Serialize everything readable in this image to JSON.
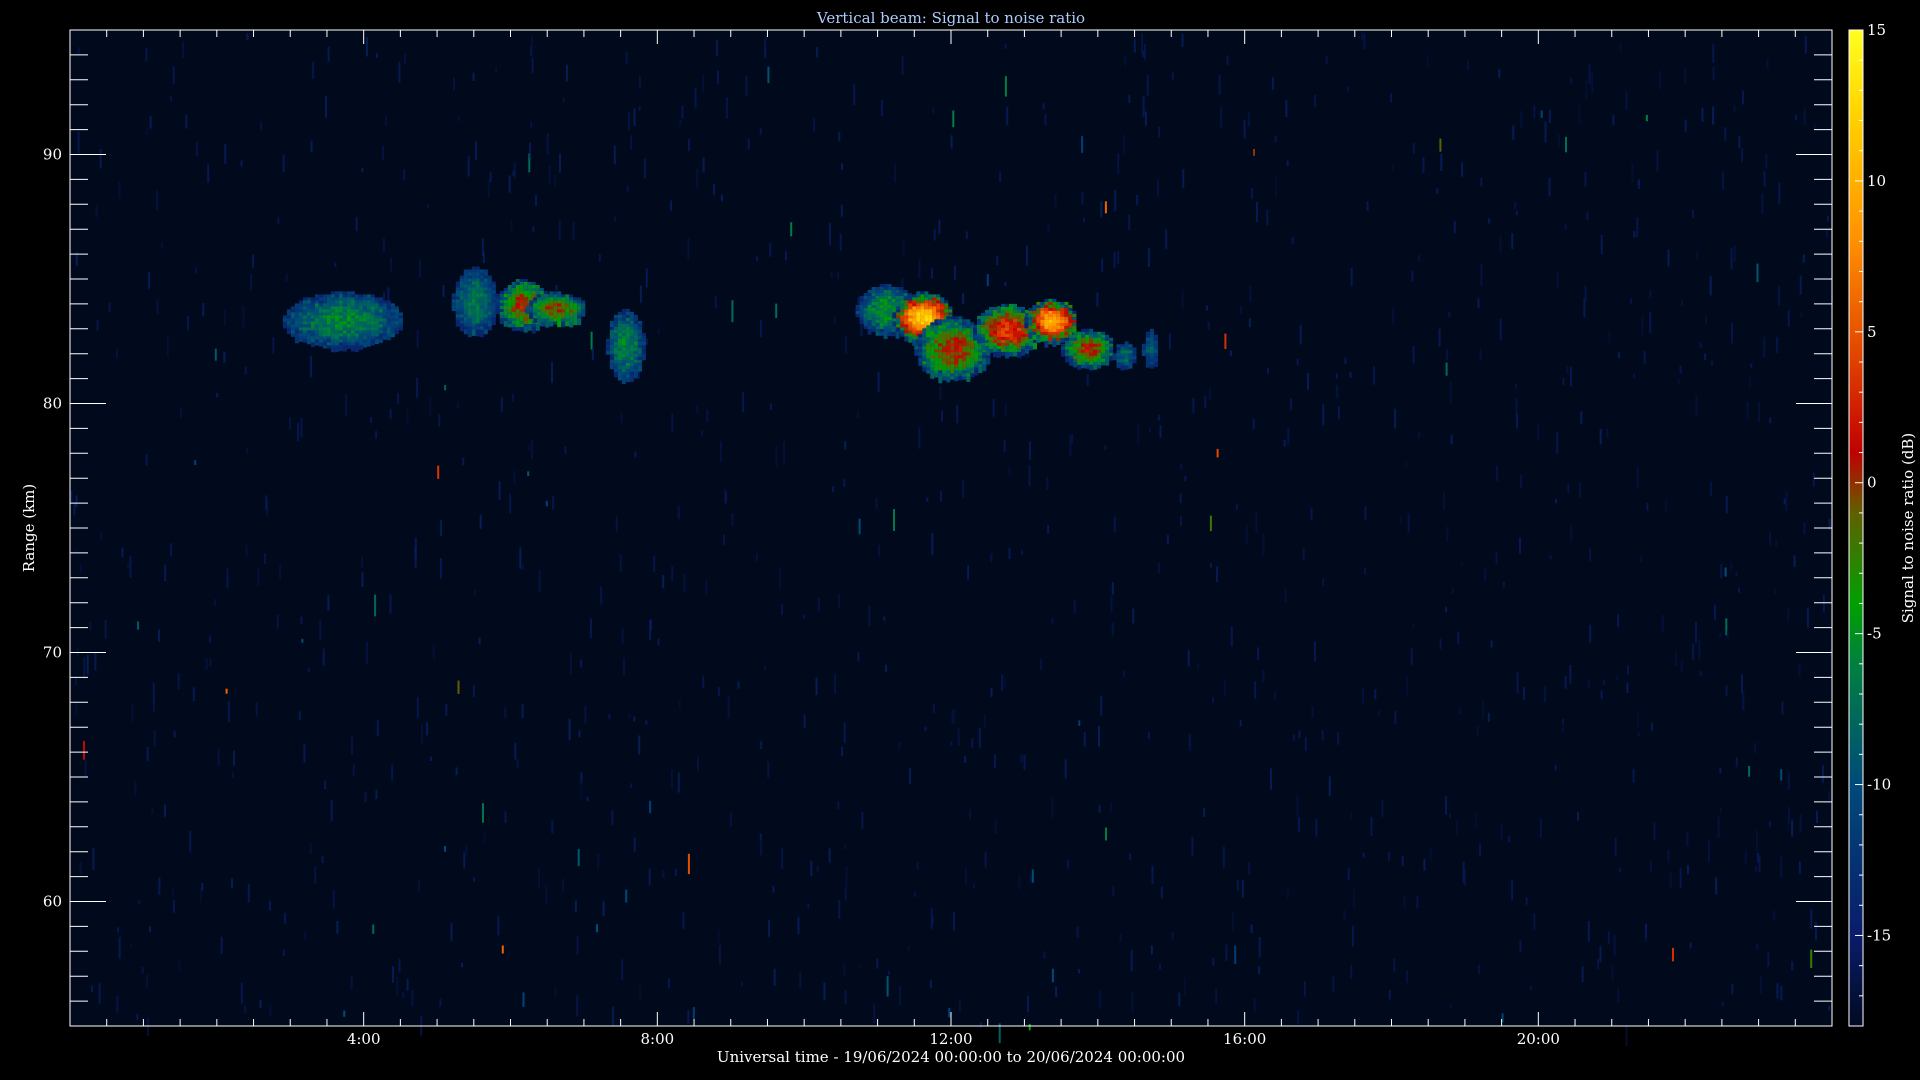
{
  "chart_data": {
    "type": "heatmap",
    "title": "Vertical beam: Signal to noise ratio",
    "xlabel": "Universal time - 19/06/2024 00:00:00 to 20/06/2024 00:00:00",
    "ylabel": "Range (km)",
    "colorbar_label": "Signal to noise ratio (dB)",
    "xlim_hours": [
      0,
      24
    ],
    "ylim_km": [
      55,
      95
    ],
    "x_ticks": [
      {
        "hour": 4,
        "label": "4:00"
      },
      {
        "hour": 8,
        "label": "8:00"
      },
      {
        "hour": 12,
        "label": "12:00"
      },
      {
        "hour": 16,
        "label": "16:00"
      },
      {
        "hour": 20,
        "label": "20:00"
      }
    ],
    "y_ticks": [
      {
        "km": 60,
        "label": "60"
      },
      {
        "km": 70,
        "label": "70"
      },
      {
        "km": 80,
        "label": "80"
      },
      {
        "km": 90,
        "label": "90"
      }
    ],
    "colorbar_range_db": [
      -18,
      15
    ],
    "colorbar_ticks": [
      {
        "db": -15,
        "label": "-15"
      },
      {
        "db": -10,
        "label": "-10"
      },
      {
        "db": -5,
        "label": "-5"
      },
      {
        "db": 0,
        "label": "0"
      },
      {
        "db": 5,
        "label": "5"
      },
      {
        "db": 10,
        "label": "10"
      },
      {
        "db": 15,
        "label": "15"
      }
    ],
    "colormap": [
      {
        "db": -18,
        "color": "#000a22"
      },
      {
        "db": -15,
        "color": "#0a1c6a"
      },
      {
        "db": -10,
        "color": "#004a7a"
      },
      {
        "db": -6,
        "color": "#008040"
      },
      {
        "db": -4,
        "color": "#00a000"
      },
      {
        "db": -1,
        "color": "#606000"
      },
      {
        "db": 1,
        "color": "#c00000"
      },
      {
        "db": 4,
        "color": "#e04000"
      },
      {
        "db": 8,
        "color": "#ff9000"
      },
      {
        "db": 12,
        "color": "#ffd000"
      },
      {
        "db": 15,
        "color": "#ffff20"
      }
    ],
    "echo_regions": [
      {
        "t0": 2.9,
        "t1": 4.5,
        "r0": 82.3,
        "r1": 84.5,
        "peak_db": -4
      },
      {
        "t0": 5.2,
        "t1": 5.8,
        "r0": 82.8,
        "r1": 85.5,
        "peak_db": -5
      },
      {
        "t0": 5.8,
        "t1": 6.5,
        "r0": 83.0,
        "r1": 85.0,
        "peak_db": 3
      },
      {
        "t0": 6.2,
        "t1": 7.0,
        "r0": 83.2,
        "r1": 84.5,
        "peak_db": 2
      },
      {
        "t0": 7.3,
        "t1": 7.8,
        "r0": 81.0,
        "r1": 83.8,
        "peak_db": -4
      },
      {
        "t0": 10.7,
        "t1": 11.5,
        "r0": 82.8,
        "r1": 84.8,
        "peak_db": -3
      },
      {
        "t0": 11.2,
        "t1": 12.0,
        "r0": 82.5,
        "r1": 84.5,
        "peak_db": 14
      },
      {
        "t0": 11.5,
        "t1": 12.5,
        "r0": 81.0,
        "r1": 83.5,
        "peak_db": 3
      },
      {
        "t0": 12.3,
        "t1": 13.2,
        "r0": 82.0,
        "r1": 84.0,
        "peak_db": 6
      },
      {
        "t0": 13.0,
        "t1": 13.7,
        "r0": 82.5,
        "r1": 84.2,
        "peak_db": 12
      },
      {
        "t0": 13.5,
        "t1": 14.2,
        "r0": 81.5,
        "r1": 83.0,
        "peak_db": 3
      },
      {
        "t0": 14.2,
        "t1": 14.5,
        "r0": 81.5,
        "r1": 82.5,
        "peak_db": -6
      },
      {
        "t0": 14.6,
        "t1": 14.8,
        "r0": 81.5,
        "r1": 83.0,
        "peak_db": -7
      }
    ]
  }
}
